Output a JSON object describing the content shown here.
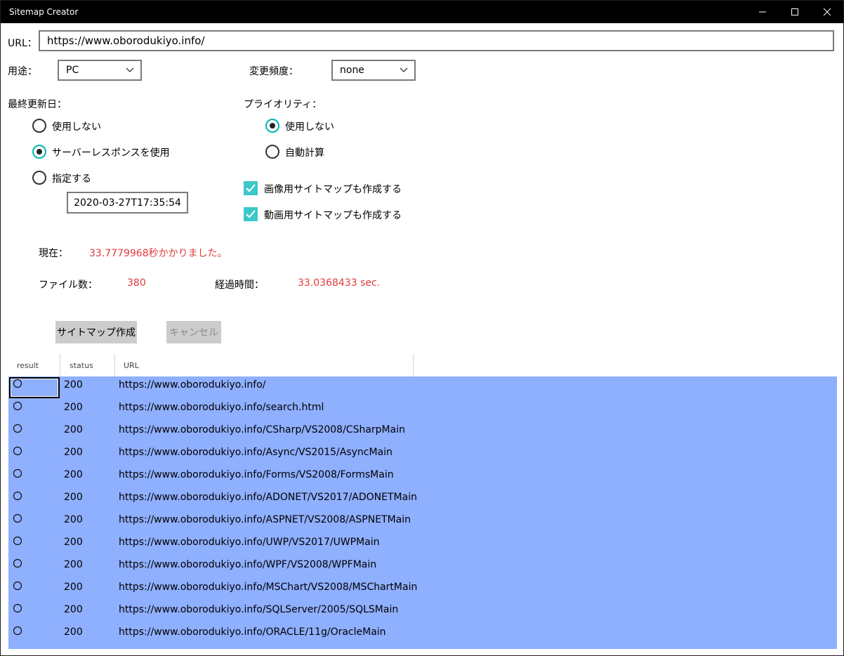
{
  "window": {
    "title": "Sitemap Creator"
  },
  "form": {
    "url_label": "URL：",
    "url_value": "https://www.oborodukiyo.info/",
    "usage_label": "用途：",
    "usage_value": "PC",
    "changefreq_label": "変更頻度：",
    "changefreq_value": "none",
    "lastmod_label": "最終更新日：",
    "lastmod_options": [
      "使用しない",
      "サーバーレスポンスを使用",
      "指定する"
    ],
    "lastmod_selected_index": 1,
    "lastmod_date": "2020-03-27T17:35:54",
    "priority_label": "プライオリティ：",
    "priority_options": [
      "使用しない",
      "自動計算"
    ],
    "priority_selected_index": 0,
    "image_sitemap_label": "画像用サイトマップも作成する",
    "image_sitemap_checked": true,
    "video_sitemap_label": "動画用サイトマップも作成する",
    "video_sitemap_checked": true
  },
  "status": {
    "current_label": "現在：",
    "current_value": "33.7779968秒かかりました。",
    "file_count_label": "ファイル数：",
    "file_count_value": "380",
    "elapsed_label": "経過時間：",
    "elapsed_value": "33.0368433 sec."
  },
  "buttons": {
    "create_label": "サイトマップ作成",
    "cancel_label": "キャンセル",
    "cancel_enabled": false
  },
  "grid": {
    "columns": [
      "result",
      "status",
      "URL"
    ],
    "rows": [
      {
        "result": "○",
        "status": "200",
        "url": "https://www.oborodukiyo.info/"
      },
      {
        "result": "○",
        "status": "200",
        "url": "https://www.oborodukiyo.info/search.html"
      },
      {
        "result": "○",
        "status": "200",
        "url": "https://www.oborodukiyo.info/CSharp/VS2008/CSharpMain"
      },
      {
        "result": "○",
        "status": "200",
        "url": "https://www.oborodukiyo.info/Async/VS2015/AsyncMain"
      },
      {
        "result": "○",
        "status": "200",
        "url": "https://www.oborodukiyo.info/Forms/VS2008/FormsMain"
      },
      {
        "result": "○",
        "status": "200",
        "url": "https://www.oborodukiyo.info/ADONET/VS2017/ADONETMain"
      },
      {
        "result": "○",
        "status": "200",
        "url": "https://www.oborodukiyo.info/ASPNET/VS2008/ASPNETMain"
      },
      {
        "result": "○",
        "status": "200",
        "url": "https://www.oborodukiyo.info/UWP/VS2017/UWPMain"
      },
      {
        "result": "○",
        "status": "200",
        "url": "https://www.oborodukiyo.info/WPF/VS2008/WPFMain"
      },
      {
        "result": "○",
        "status": "200",
        "url": "https://www.oborodukiyo.info/MSChart/VS2008/MSChartMain"
      },
      {
        "result": "○",
        "status": "200",
        "url": "https://www.oborodukiyo.info/SQLServer/2005/SQLSMain"
      },
      {
        "result": "○",
        "status": "200",
        "url": "https://www.oborodukiyo.info/ORACLE/11g/OracleMain"
      }
    ]
  },
  "colors": {
    "accent": "#3cc8c8",
    "status_red": "#e03b3b",
    "grid_selection": "#8fafff"
  }
}
